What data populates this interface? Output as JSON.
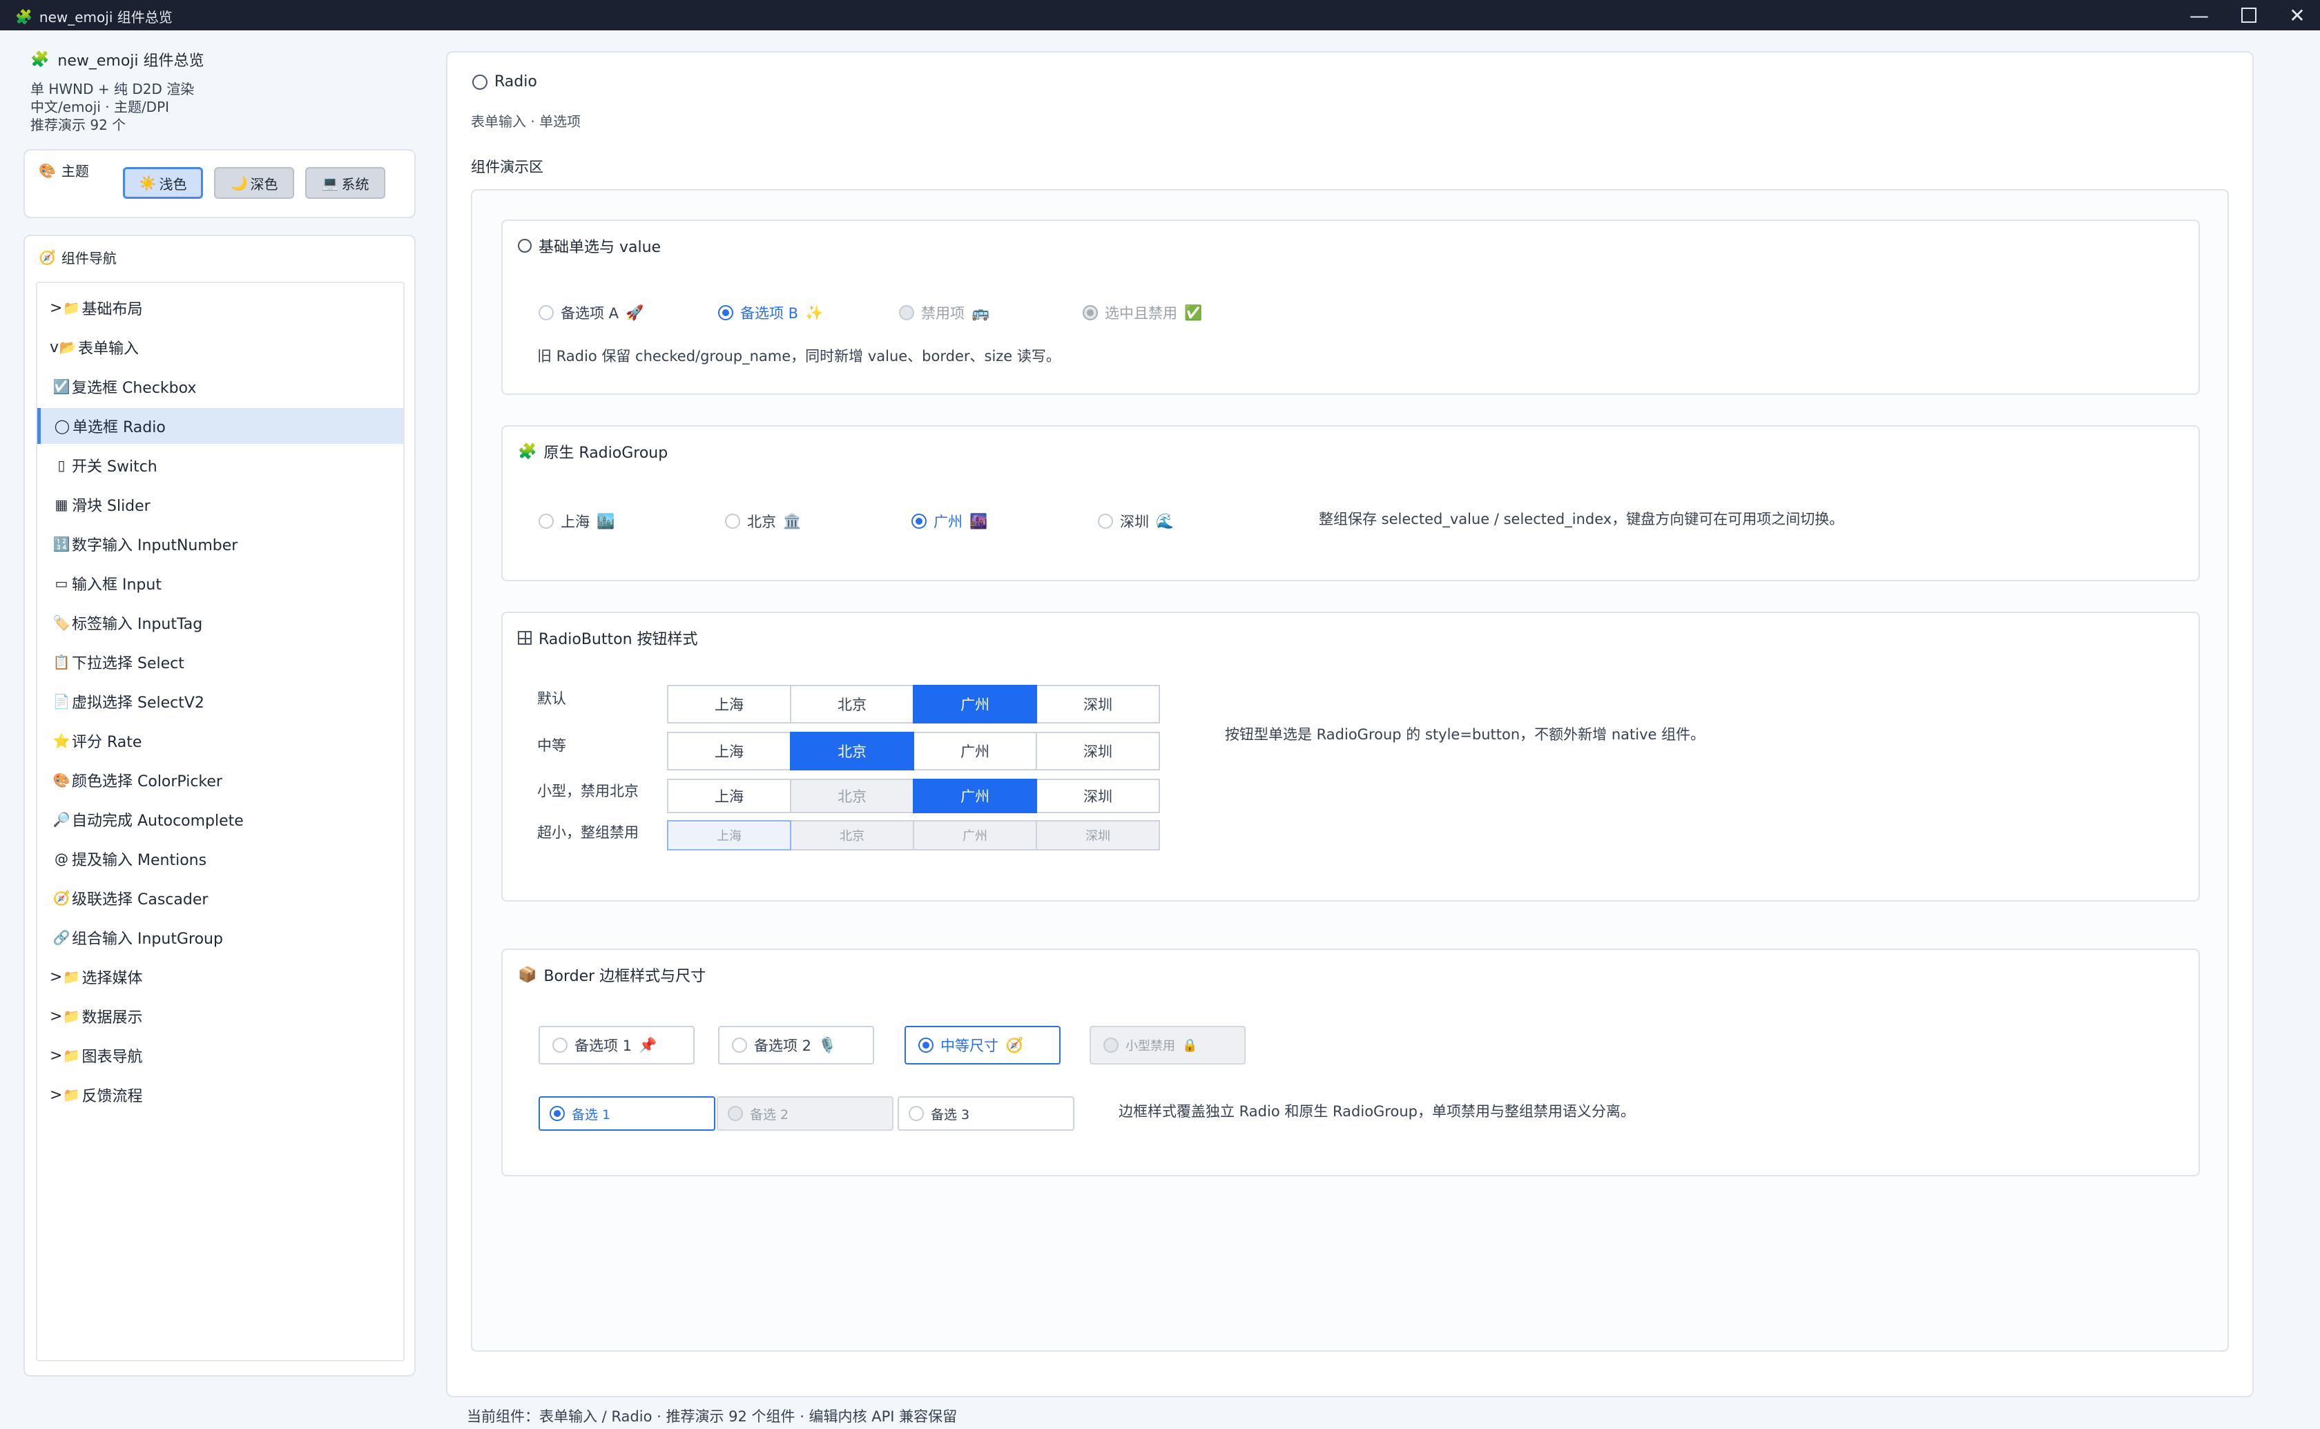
{
  "window": {
    "title": "new_emoji 组件总览",
    "icon": "puzzle-icon"
  },
  "sidebar": {
    "app_title": "new_emoji 组件总览",
    "info": [
      "单 HWND + 纯 D2D 渲染",
      "中文/emoji · 主题/DPI",
      "推荐演示 92 个"
    ],
    "theme": {
      "label": "主题",
      "buttons": [
        {
          "label": "浅色",
          "icon": "☀️",
          "active": true
        },
        {
          "label": "深色",
          "icon": "🌙",
          "active": false
        },
        {
          "label": "系统",
          "icon": "💻",
          "active": false
        }
      ]
    },
    "nav": {
      "label": "组件导航",
      "items": [
        {
          "label": "基础布局",
          "prefix": ">",
          "icon": "📁"
        },
        {
          "label": "表单输入",
          "prefix": "v",
          "icon": "📂"
        },
        {
          "label": "复选框 Checkbox",
          "icon": "☑️"
        },
        {
          "label": "单选框 Radio",
          "icon": "◯",
          "active": true
        },
        {
          "label": "开关 Switch",
          "icon": "▯"
        },
        {
          "label": "滑块 Slider",
          "icon": "▦"
        },
        {
          "label": "数字输入 InputNumber",
          "icon": "🔢"
        },
        {
          "label": "输入框 Input",
          "icon": "▭"
        },
        {
          "label": "标签输入 InputTag",
          "icon": "🏷️"
        },
        {
          "label": "下拉选择 Select",
          "icon": "📋"
        },
        {
          "label": "虚拟选择 SelectV2",
          "icon": "📄"
        },
        {
          "label": "评分 Rate",
          "icon": "⭐"
        },
        {
          "label": "颜色选择 ColorPicker",
          "icon": "🎨"
        },
        {
          "label": "自动完成 Autocomplete",
          "icon": "🔎"
        },
        {
          "label": "提及输入 Mentions",
          "icon": "@"
        },
        {
          "label": "级联选择 Cascader",
          "icon": "🧭"
        },
        {
          "label": "组合输入 InputGroup",
          "icon": "🔗"
        },
        {
          "label": "选择媒体",
          "prefix": ">",
          "icon": "📁"
        },
        {
          "label": "数据展示",
          "prefix": ">",
          "icon": "📁"
        },
        {
          "label": "图表导航",
          "prefix": ">",
          "icon": "📁"
        },
        {
          "label": "反馈流程",
          "prefix": ">",
          "icon": "📁"
        }
      ]
    }
  },
  "main": {
    "title": "Radio",
    "subtitle": "表单输入 · 单选项",
    "demo_label": "组件演示区",
    "sections": {
      "basic": {
        "title": "基础单选与 value",
        "options": [
          {
            "label": "备选项 A",
            "emoji": "🚀",
            "checked": false,
            "disabled": false
          },
          {
            "label": "备选项 B",
            "emoji": "✨",
            "checked": true,
            "disabled": false
          },
          {
            "label": "禁用项",
            "emoji": "🚌",
            "checked": false,
            "disabled": true
          },
          {
            "label": "选中且禁用",
            "emoji": "✅",
            "checked": true,
            "disabled": true
          }
        ],
        "note": "旧 Radio 保留 checked/group_name，同时新增 value、border、size 读写。"
      },
      "group": {
        "title": "原生 RadioGroup",
        "options": [
          {
            "label": "上海",
            "emoji": "🏙️",
            "checked": false
          },
          {
            "label": "北京",
            "emoji": "🏛️",
            "checked": false
          },
          {
            "label": "广州",
            "emoji": "🌆",
            "checked": true
          },
          {
            "label": "深圳",
            "emoji": "🌊",
            "checked": false
          }
        ],
        "note": "整组保存 selected_value / selected_index，键盘方向键可在可用项之间切换。"
      },
      "button": {
        "title": "RadioButton 按钮样式",
        "rows": [
          {
            "label": "默认",
            "options": [
              "上海",
              "北京",
              "广州",
              "深圳"
            ],
            "selected": 2,
            "disabled": []
          },
          {
            "label": "中等",
            "options": [
              "上海",
              "北京",
              "广州",
              "深圳"
            ],
            "selected": 1,
            "disabled": []
          },
          {
            "label": "小型，禁用北京",
            "options": [
              "上海",
              "北京",
              "广州",
              "深圳"
            ],
            "selected": 2,
            "disabled": [
              1
            ]
          },
          {
            "label": "超小，整组禁用",
            "options": [
              "上海",
              "北京",
              "广州",
              "深圳"
            ],
            "selected": -1,
            "disabled": [
              0,
              1,
              2,
              3
            ]
          }
        ],
        "note": "按钮型单选是 RadioGroup 的 style=button，不额外新增 native 组件。"
      },
      "border": {
        "title": "Border 边框样式与尺寸",
        "row1": [
          {
            "label": "备选项 1",
            "emoji": "📌",
            "checked": false,
            "disabled": false
          },
          {
            "label": "备选项 2",
            "emoji": "🎙️",
            "checked": false,
            "disabled": false
          },
          {
            "label": "中等尺寸",
            "emoji": "🧭",
            "checked": true,
            "disabled": false
          },
          {
            "label": "小型禁用",
            "emoji": "🔒",
            "checked": false,
            "disabled": true
          }
        ],
        "row2": [
          {
            "label": "备选 1",
            "checked": true,
            "disabled": false
          },
          {
            "label": "备选 2",
            "checked": false,
            "disabled": true
          },
          {
            "label": "备选 3",
            "checked": false,
            "disabled": false
          }
        ],
        "note": "边框样式覆盖独立 Radio 和原生 RadioGroup，单项禁用与整组禁用语义分离。"
      }
    }
  },
  "status": "当前组件：表单输入 / Radio · 推荐演示 92 个组件 · 编辑内核 API 兼容保留",
  "colors": {
    "accent": "#1e6af0",
    "titlebar": "#1c2131",
    "background": "#f3f6fb"
  }
}
